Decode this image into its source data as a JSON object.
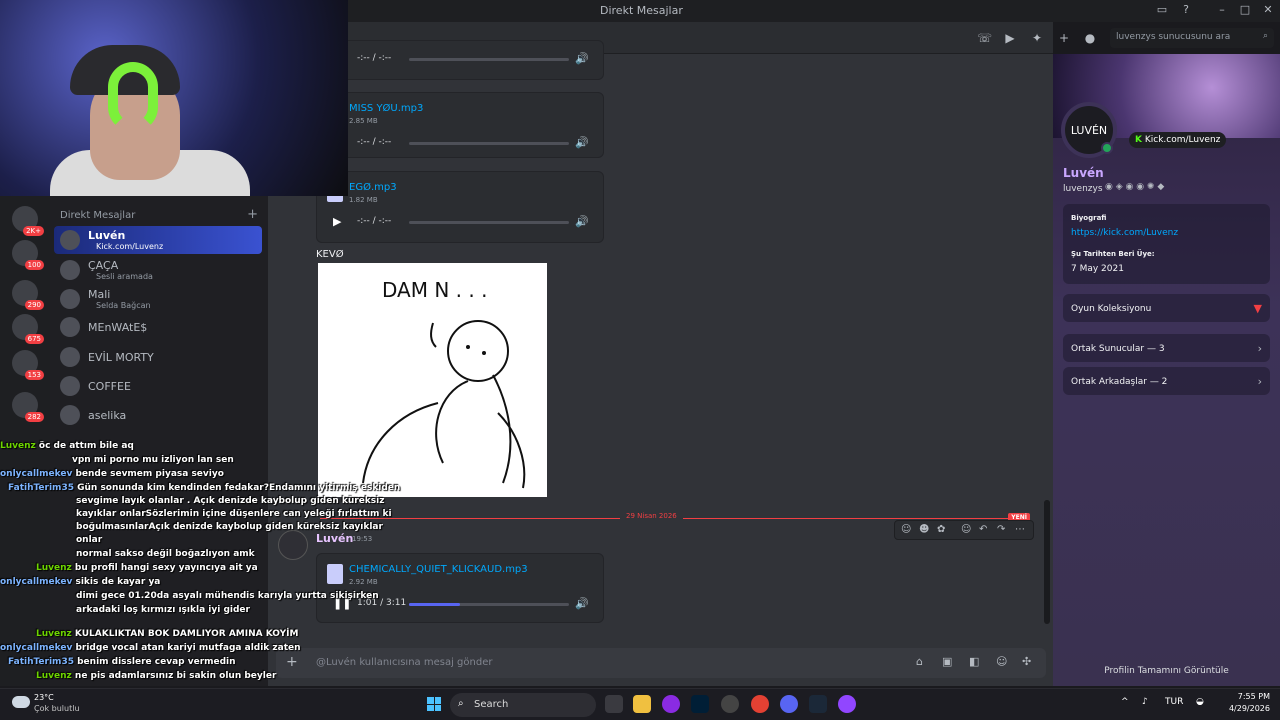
{
  "titlebar": {
    "title": "Direkt Mesajlar"
  },
  "search": {
    "placeholder": "luvenzys sunucusunu ara"
  },
  "servers": {
    "badges": [
      "2K+",
      "100",
      "290",
      "675",
      "153",
      "282"
    ]
  },
  "dm": {
    "header": "Direkt Mesajlar",
    "add": "+",
    "items": [
      {
        "name": "Luvén",
        "sub": "Kick.com/Luvenz"
      },
      {
        "name": "ÇAÇA",
        "sub": "Sesli aramada"
      },
      {
        "name": "Mali",
        "sub": "Selda Bağcan"
      },
      {
        "name": "MEnWAtE$",
        "sub": ""
      },
      {
        "name": "EVİL MORTY",
        "sub": ""
      },
      {
        "name": "COFFEE",
        "sub": ""
      },
      {
        "name": "aselika",
        "sub": ""
      }
    ]
  },
  "chat": {
    "attachments": [
      {
        "name": "",
        "size": "",
        "time": "-:-- / -:--",
        "progress": 0
      },
      {
        "name": "MISS YØU.mp3",
        "size": "2.85 MB",
        "time": "-:-- / -:--",
        "progress": 0
      },
      {
        "name": "EGØ.mp3",
        "size": "1.82 MB",
        "time": "-:-- / -:--",
        "progress": 0
      }
    ],
    "image_caption": "KEVØ",
    "drawing_text": "DAM N . . .",
    "date_separator": "29 Nisan 2026",
    "new_badge": "YENİ",
    "message": {
      "author": "Luvén",
      "time": "19:53",
      "file": {
        "name": "CHEMICALLY_QUIET_KLICKAUD.mp3",
        "size": "2.92 MB",
        "time": "1:01 / 3:11",
        "progress": 0.32
      }
    },
    "input_placeholder": "@Luvén kullanıcısına mesaj gönder"
  },
  "profile": {
    "avatar_text": "LUVÉN",
    "kick": "Kick.com/Luvenz",
    "display_name": "Luvén",
    "username": "luvenzys",
    "bio_label": "Biyografi",
    "bio_link": "https://kick.com/Luvenz",
    "member_since_label": "Şu Tarihten Beri Üye:",
    "member_since": "7 May 2021",
    "game_collection": "Oyun Koleksiyonu",
    "mutual_servers": "Ortak Sunucular — 3",
    "mutual_friends": "Ortak Arkadaşlar — 2",
    "view_full": "Profilin Tamamını Görüntüle"
  },
  "overlay_chat": [
    {
      "user": "Luvenz",
      "user_color": "#6dd400",
      "text": "öc de attım bile aq"
    },
    {
      "user": "",
      "user_color": "#ff3b3b",
      "text": "vpn mi porno mu izliyon lan sen"
    },
    {
      "user": "onlycallmekev",
      "user_color": "#7db4ff",
      "text": "bende sevmem piyasa seviyo"
    },
    {
      "user": "FatihTerim35",
      "user_color": "#7db4ff",
      "text": "Gün sonunda kim kendinden fedakar?Endamını yitirmiş eskiden"
    },
    {
      "user": "",
      "user_color": "#ffffff",
      "text": "sevgime layık olanlar . Açık denizde kaybolup giden küreksiz"
    },
    {
      "user": "",
      "user_color": "#ffffff",
      "text": "kayıklar onlarSözlerimin içine düşenlere can yeleği fırlattım ki"
    },
    {
      "user": "",
      "user_color": "#ffffff",
      "text": "boğulmasınlarAçık denizde kaybolup giden küreksiz kayıklar"
    },
    {
      "user": "",
      "user_color": "#ffffff",
      "text": "onlar"
    },
    {
      "user": "",
      "user_color": "#ff3b3b",
      "text": "normal sakso değil boğazlıyon amk"
    },
    {
      "user": "Luvenz",
      "user_color": "#6dd400",
      "text": "bu profil hangi sexy yayıncıya ait ya"
    },
    {
      "user": "onlycallmekev",
      "user_color": "#7db4ff",
      "text": "sikis de kayar ya"
    },
    {
      "user": "",
      "user_color": "#ff3b3b",
      "text": "dimi gece 01.20da asyalı mühendis karıyla yurtta sikişirken"
    },
    {
      "user": "",
      "user_color": "#ffffff",
      "text": "arkadaki loş kırmızı ışıkla iyi gider"
    },
    {
      "user": "Luvenz",
      "user_color": "#6dd400",
      "text": "KULAKLIKTAN BOK DAMLIYOR AMINA KOYİM"
    },
    {
      "user": "onlycallmekev",
      "user_color": "#7db4ff",
      "text": "bridge vocal atan kariyi mutfaga aldik zaten"
    },
    {
      "user": "FatihTerim35",
      "user_color": "#7db4ff",
      "text": "benim disslere cevap vermedin"
    },
    {
      "user": "Luvenz",
      "user_color": "#6dd400",
      "text": "ne pis adamlarsınız bi sakin olun beyler"
    }
  ],
  "taskbar": {
    "temp": "23°C",
    "condition": "Çok bulutlu",
    "search": "Search",
    "lang": "TUR",
    "time": "7:55 PM",
    "date": "4/29/2026"
  },
  "colors": {
    "blurple": "#5865f2",
    "link": "#00a8fc",
    "danger": "#f23f43",
    "online": "#23a55a",
    "kick_green": "#53fc18"
  }
}
